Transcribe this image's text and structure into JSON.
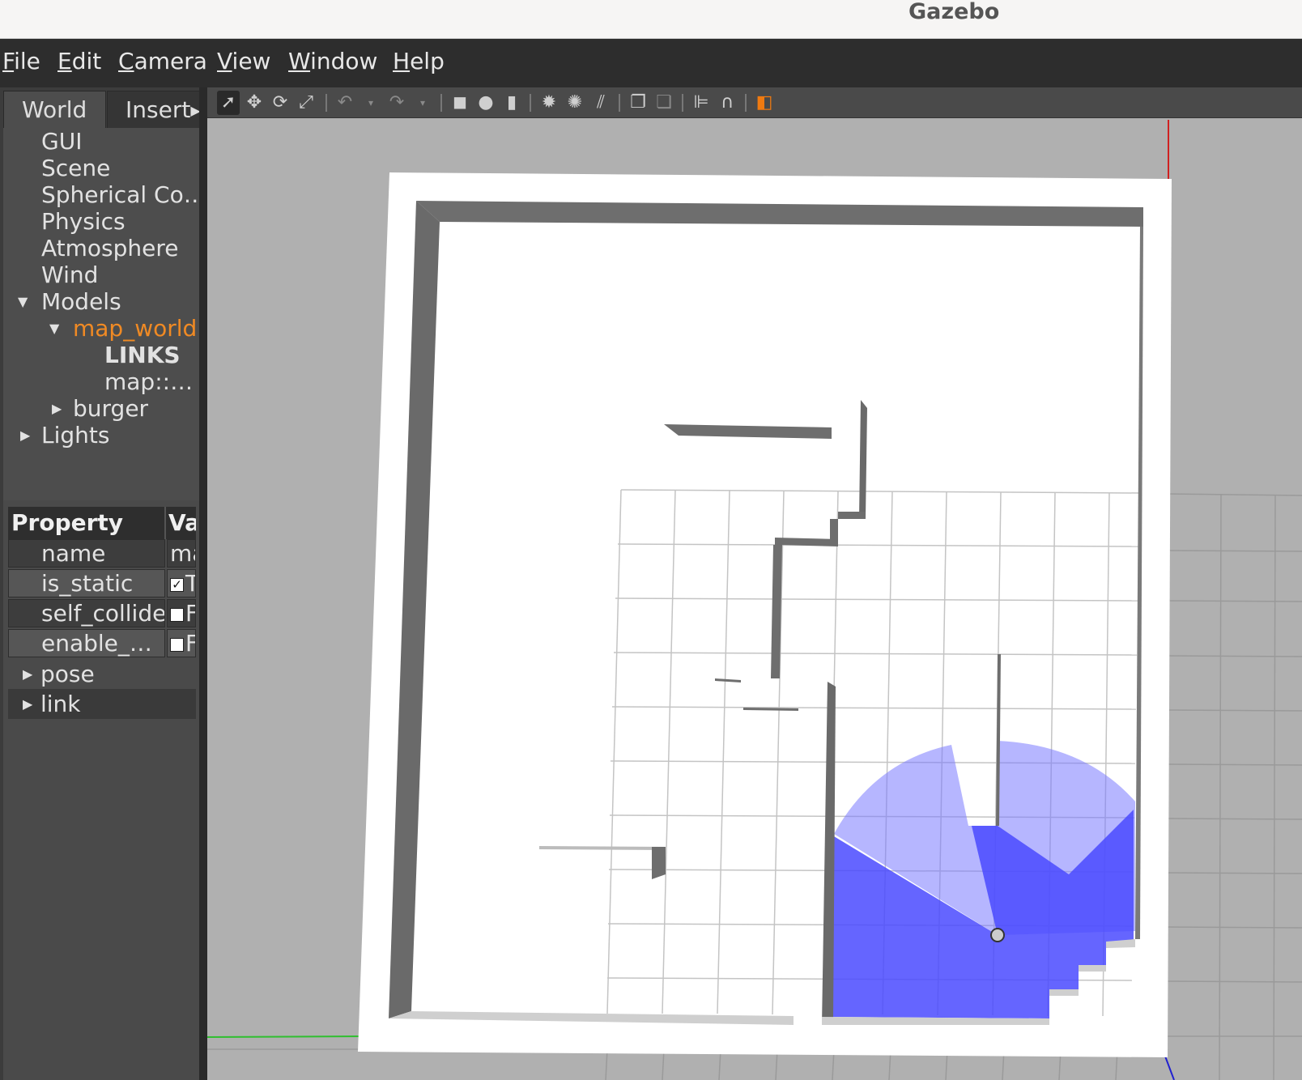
{
  "window": {
    "title": "Gazebo"
  },
  "menu": [
    {
      "accel": "F",
      "rest": "ile"
    },
    {
      "accel": "E",
      "rest": "dit"
    },
    {
      "accel": "C",
      "rest": "amera"
    },
    {
      "accel": "V",
      "rest": "iew"
    },
    {
      "accel": "W",
      "rest": "indow"
    },
    {
      "accel": "H",
      "rest": "elp"
    }
  ],
  "tabs": {
    "world": "World",
    "insert": "Insert"
  },
  "tree": {
    "gui": "GUI",
    "scene": "Scene",
    "spherical": "Spherical Co…",
    "physics": "Physics",
    "atmosphere": "Atmosphere",
    "wind": "Wind",
    "models": "Models",
    "map_world": "map_world",
    "links": "LINKS",
    "map_link": "map::…",
    "burger": "burger",
    "lights": "Lights"
  },
  "properties": {
    "header_property": "Property",
    "header_value": "Va",
    "rows": [
      {
        "key": "name",
        "value": "ma"
      },
      {
        "key": "is_static",
        "value": "T",
        "checked": true
      },
      {
        "key": "self_collide",
        "value": "F",
        "checked": false
      },
      {
        "key": "enable_…",
        "value": "F",
        "checked": false
      }
    ],
    "groups": {
      "pose": "pose",
      "link": "link"
    }
  },
  "toolbar_icons": [
    "select-arrow-icon",
    "translate-icon",
    "rotate-icon",
    "scale-icon",
    "undo-icon",
    "undo-history-icon",
    "redo-icon",
    "redo-history-icon",
    "box-shape-icon",
    "sphere-shape-icon",
    "cylinder-shape-icon",
    "point-light-icon",
    "spot-light-icon",
    "directional-light-icon",
    "copy-icon",
    "paste-icon",
    "align-icon",
    "snap-icon",
    "view-angle-icon"
  ],
  "colors": {
    "selected_tree": "#f08a24",
    "laser": "#3b3bff",
    "floor": "#ffffff",
    "wall": "#6e6e6e",
    "background": "#b0b0b0"
  }
}
